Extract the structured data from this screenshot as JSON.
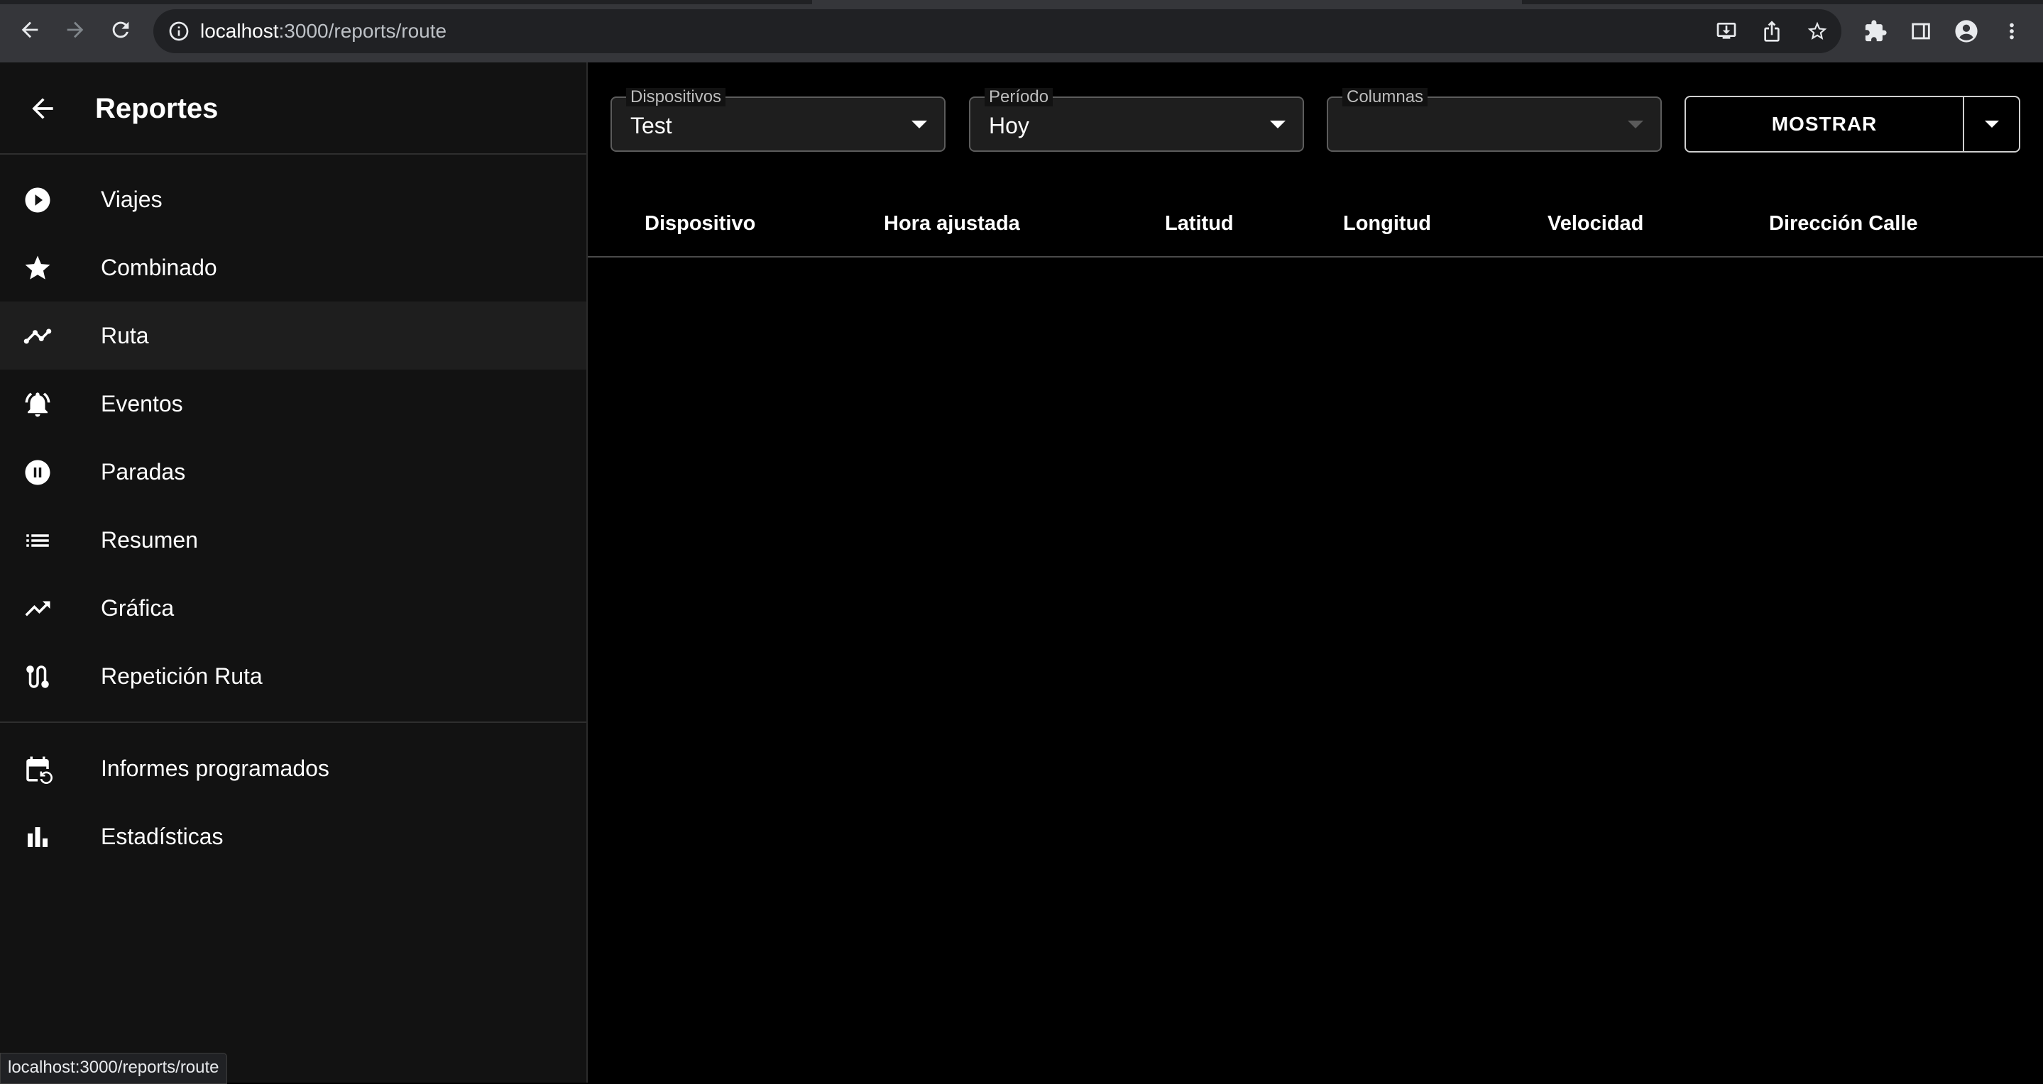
{
  "browser": {
    "url_host": "localhost",
    "url_rest": ":3000/reports/route",
    "status_url": "localhost:3000/reports/route"
  },
  "sidebar": {
    "title": "Reportes",
    "items": [
      {
        "label": "Viajes",
        "icon": "play-circle-icon"
      },
      {
        "label": "Combinado",
        "icon": "star-icon"
      },
      {
        "label": "Ruta",
        "icon": "timeline-icon",
        "selected": true
      },
      {
        "label": "Eventos",
        "icon": "notifications-active-icon"
      },
      {
        "label": "Paradas",
        "icon": "pause-circle-icon"
      },
      {
        "label": "Resumen",
        "icon": "format-list-icon"
      },
      {
        "label": "Gráfica",
        "icon": "trending-up-icon"
      },
      {
        "label": "Repetición Ruta",
        "icon": "route-icon"
      }
    ],
    "secondary_items": [
      {
        "label": "Informes programados",
        "icon": "event-repeat-icon"
      },
      {
        "label": "Estadísticas",
        "icon": "bar-chart-icon"
      }
    ]
  },
  "filters": {
    "devices": {
      "label": "Dispositivos",
      "value": "Test"
    },
    "period": {
      "label": "Período",
      "value": "Hoy"
    },
    "columns": {
      "label": "Columnas",
      "value": ""
    },
    "show_button": "MOSTRAR"
  },
  "table": {
    "columns": [
      "Dispositivo",
      "Hora ajustada",
      "Latitud",
      "Longitud",
      "Velocidad",
      "Dirección Calle"
    ],
    "rows": []
  },
  "colors": {
    "background": "#000000",
    "sidebar": "#121212",
    "selected_item": "#1e1e1e",
    "chrome": "#35363a"
  }
}
